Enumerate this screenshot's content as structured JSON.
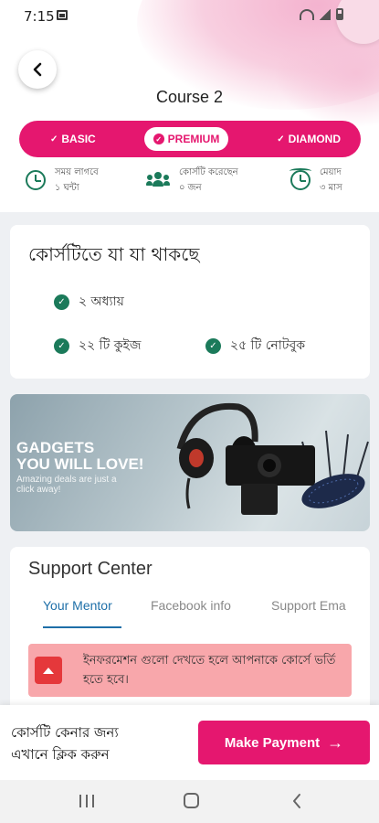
{
  "status_bar": {
    "time": "7:15"
  },
  "header": {
    "title": "Course 2"
  },
  "plans": [
    {
      "label": "BASIC",
      "active": false
    },
    {
      "label": "PREMIUM",
      "active": true
    },
    {
      "label": "DIAMOND",
      "active": false
    }
  ],
  "stats": [
    {
      "line1": "সময় লাগবে",
      "line2": "১ ঘন্টা",
      "icon": "clock-icon"
    },
    {
      "line1": "কোর্সটি করেছেন",
      "line2": "০ জন",
      "icon": "people-icon"
    },
    {
      "line1": "মেয়াদ",
      "line2": "৩ মাস",
      "icon": "alarm-icon"
    }
  ],
  "contents": {
    "title": "কোর্সটিতে যা যা থাকছে",
    "items": [
      "২ অধ্যায়",
      "২২ টি কুইজ",
      "২৫ টি নোটবুক"
    ]
  },
  "banner": {
    "line1": "GADGETS",
    "line2": "YOU WILL LOVE!",
    "subtitle": "Amazing deals are just a click away!"
  },
  "support": {
    "title": "Support Center",
    "tabs": [
      "Your Mentor",
      "Facebook info",
      "Support Ema"
    ],
    "active_tab": 0,
    "alert_text": "ইনফরমেশন গুলো দেখতে হলে আপনাকে কোর্সে ভর্তি হতে হবে।"
  },
  "footer": {
    "buy_text_line1": "কোর্সটি কেনার জন্য",
    "buy_text_line2": "এখানে ক্লিক করুন",
    "pay_button": "Make Payment",
    "pay_icon": "arrow-right-icon"
  },
  "colors": {
    "accent": "#e5176f",
    "green": "#1b7a5a",
    "tab_active": "#1e6fa8",
    "alert_bg": "#f8a7ab",
    "alert_icon": "#e5383b"
  }
}
